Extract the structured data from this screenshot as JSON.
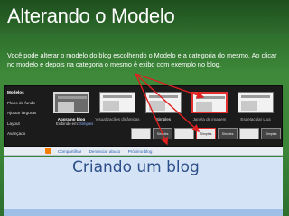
{
  "slide": {
    "title": "Alterando o Modelo",
    "description": "Você pode alterar o modelo do blog escolhendo o Modelo e a categoria do mesmo. Ao clicar no modelo e depois na categoria o mesmo é exibo com exemplo no blog."
  },
  "designer": {
    "sidebar": [
      "Modelos",
      "Plano de fundo",
      "Ajustar larguras",
      "Layout",
      "Avançado"
    ],
    "templates": [
      {
        "label": "Agora no blog"
      },
      {
        "label": "Visualizações dinâmicas"
      },
      {
        "label": "Simples"
      },
      {
        "label": "Janela de imagem"
      },
      {
        "label": "Espetacular Lixa"
      }
    ],
    "selected_template_subtitle_prefix": "Exibindo em:",
    "selected_template_subtitle_link": "Simples",
    "variants": [
      "",
      "Simples",
      "",
      "Simples",
      "Simples",
      "",
      "Simples",
      "Simples"
    ]
  },
  "navbar": {
    "links": [
      "Compartilhar",
      "Denunciar abuso",
      "Próximo blog"
    ]
  },
  "blog": {
    "title": "Criando um blog"
  },
  "colors": {
    "slide_background": "#3a8537",
    "arrow": "#e02020",
    "blog_background": "#d4e4f6",
    "blog_title": "#2e4f8a"
  }
}
